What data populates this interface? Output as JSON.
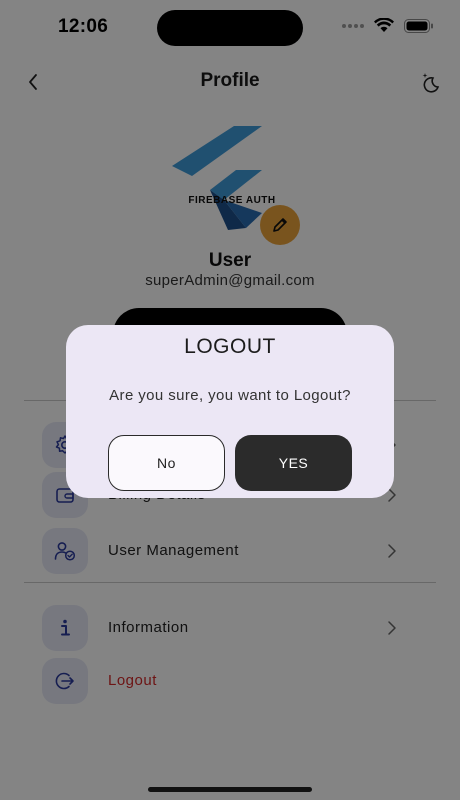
{
  "status_bar": {
    "time": "12:06"
  },
  "header": {
    "title": "Profile"
  },
  "profile": {
    "avatar_text": "FIREBASE AUTH",
    "name": "User",
    "email": "superAdmin@gmail.com"
  },
  "menu": {
    "items": [
      {
        "label": "",
        "icon": "gear-icon"
      },
      {
        "label": "Billing Details",
        "icon": "wallet-icon"
      },
      {
        "label": "User Management",
        "icon": "user-check-icon"
      },
      {
        "label": "Information",
        "icon": "info-icon"
      },
      {
        "label": "Logout",
        "icon": "logout-icon"
      }
    ]
  },
  "dialog": {
    "title": "LOGOUT",
    "message": "Are you sure, you want to Logout?",
    "no_label": "No",
    "yes_label": "YES"
  },
  "colors": {
    "accent_orange": "#e9a23b",
    "logout_red": "#d12a2a",
    "icon_bg": "#e5e7f4",
    "icon_blue": "#2b3a9c",
    "dialog_bg": "#ece7f5"
  }
}
